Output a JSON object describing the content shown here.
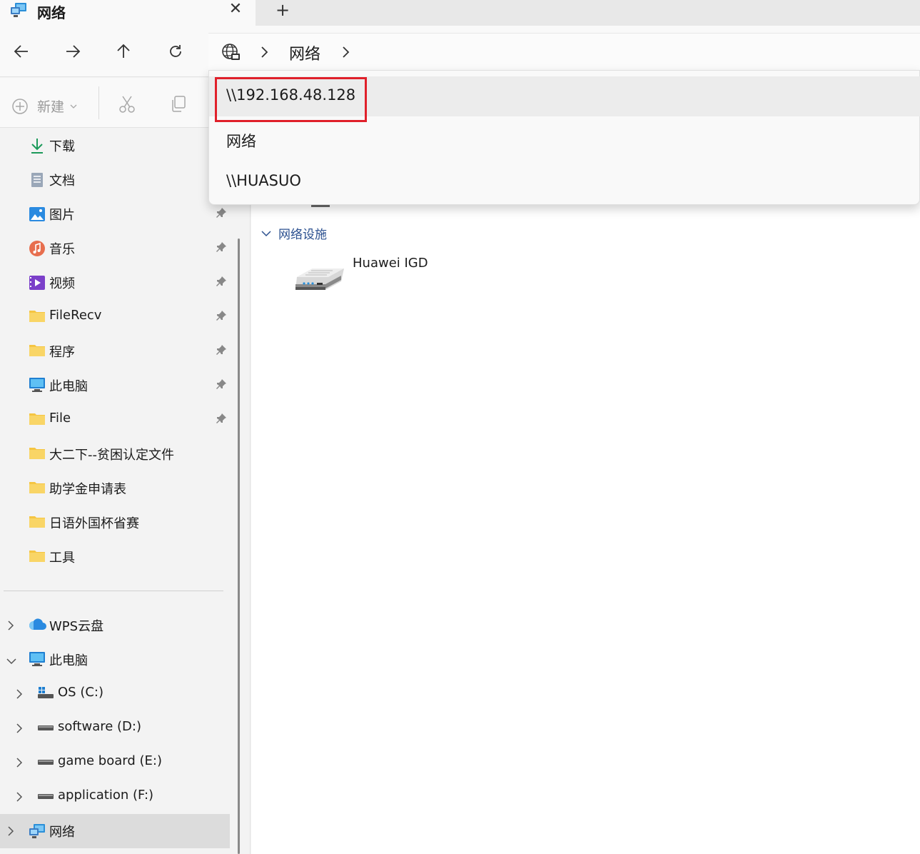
{
  "window": {
    "tab_title": "网络",
    "close_glyph": "✕",
    "new_tab_glyph": "+"
  },
  "address": {
    "crumbs": [
      "网络"
    ]
  },
  "commandbar": {
    "new_label": "新建"
  },
  "dropdown": {
    "items": [
      "\\\\192.168.48.128",
      "网络",
      "\\\\HUASUO"
    ],
    "highlighted_index": 0
  },
  "sidebar": {
    "quick_access": [
      {
        "label": "下载",
        "icon": "download-icon",
        "pinned": false
      },
      {
        "label": "文档",
        "icon": "document-icon",
        "pinned": false
      },
      {
        "label": "图片",
        "icon": "pictures-icon",
        "pinned": true
      },
      {
        "label": "音乐",
        "icon": "music-icon",
        "pinned": true
      },
      {
        "label": "视频",
        "icon": "video-icon",
        "pinned": true
      },
      {
        "label": "FileRecv",
        "icon": "folder-icon",
        "pinned": true
      },
      {
        "label": "程序",
        "icon": "folder-icon",
        "pinned": true
      },
      {
        "label": "此电脑",
        "icon": "computer-icon",
        "pinned": true
      },
      {
        "label": "File",
        "icon": "folder-icon",
        "pinned": true
      },
      {
        "label": "大二下--贫困认定文件",
        "icon": "folder-icon",
        "pinned": false
      },
      {
        "label": "助学金申请表",
        "icon": "folder-icon",
        "pinned": false
      },
      {
        "label": "日语外国杯省赛",
        "icon": "folder-icon",
        "pinned": false
      },
      {
        "label": "工具",
        "icon": "folder-icon",
        "pinned": false
      }
    ],
    "tree": [
      {
        "label": "WPS云盘",
        "icon": "cloud-icon",
        "expanded": false
      },
      {
        "label": "此电脑",
        "icon": "computer-icon",
        "expanded": true
      },
      {
        "label": "OS (C:)",
        "icon": "system-drive-icon",
        "expanded": false
      },
      {
        "label": "software (D:)",
        "icon": "drive-icon",
        "expanded": false
      },
      {
        "label": "game board (E:)",
        "icon": "drive-icon",
        "expanded": false
      },
      {
        "label": "application (F:)",
        "icon": "drive-icon",
        "expanded": false
      },
      {
        "label": "网络",
        "icon": "network-icon",
        "expanded": false,
        "selected": true
      }
    ]
  },
  "content": {
    "group_label": "网络设施",
    "devices": [
      {
        "name": "Huawei IGD",
        "icon": "router-icon"
      }
    ]
  },
  "colors": {
    "highlight_border": "#e0202a",
    "group_header": "#2a4f8f",
    "folder": "#f5c542"
  }
}
